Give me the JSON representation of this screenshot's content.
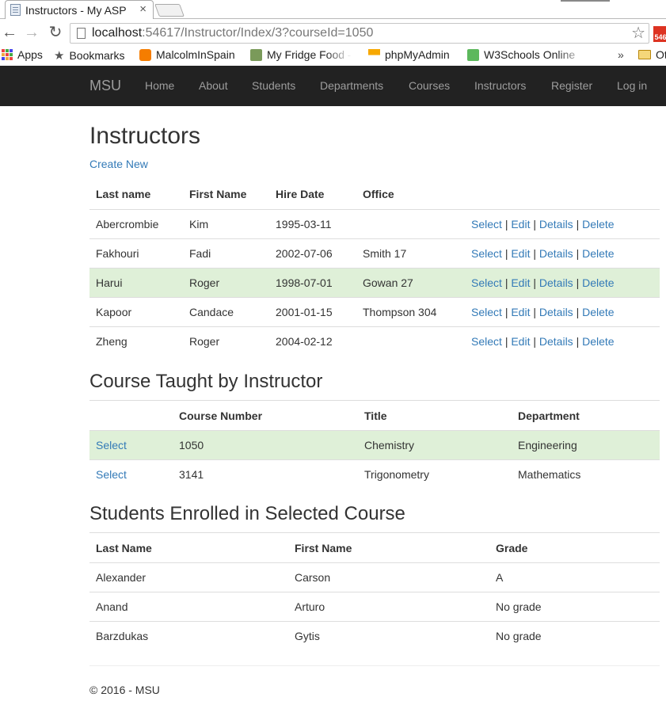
{
  "browser": {
    "tab_title": "Instructors - My ASP",
    "tab_close": "×",
    "url_host": "localhost",
    "url_rest": ":54617/Instructor/Index/3?courseId=1050",
    "ext_badge": "546",
    "bookmarks": {
      "apps": "Apps",
      "bookmarks": "Bookmarks",
      "malcolm": "MalcolmInSpain",
      "fridge": "My Fridge Food -",
      "pma": "phpMyAdmin",
      "w3": "W3Schools Online",
      "more": "»",
      "other": "Ot"
    }
  },
  "nav": {
    "brand": "MSU",
    "links": [
      "Home",
      "About",
      "Students",
      "Departments",
      "Courses",
      "Instructors",
      "Register",
      "Log in"
    ]
  },
  "page": {
    "title": "Instructors",
    "create_new": "Create New"
  },
  "instructors": {
    "headers": [
      "Last name",
      "First Name",
      "Hire Date",
      "Office"
    ],
    "actions": [
      "Select",
      "Edit",
      "Details",
      "Delete"
    ],
    "rows": [
      {
        "last": "Abercrombie",
        "first": "Kim",
        "hire": "1995-03-11",
        "office": ""
      },
      {
        "last": "Fakhouri",
        "first": "Fadi",
        "hire": "2002-07-06",
        "office": "Smith 17"
      },
      {
        "last": "Harui",
        "first": "Roger",
        "hire": "1998-07-01",
        "office": "Gowan 27"
      },
      {
        "last": "Kapoor",
        "first": "Candace",
        "hire": "2001-01-15",
        "office": "Thompson 304"
      },
      {
        "last": "Zheng",
        "first": "Roger",
        "hire": "2004-02-12",
        "office": ""
      }
    ]
  },
  "courses": {
    "title": "Course Taught by Instructor",
    "headers": [
      "",
      "Course Number",
      "Title",
      "Department"
    ],
    "select_label": "Select",
    "rows": [
      {
        "number": "1050",
        "title": "Chemistry",
        "department": "Engineering"
      },
      {
        "number": "3141",
        "title": "Trigonometry",
        "department": "Mathematics"
      }
    ]
  },
  "students": {
    "title": "Students Enrolled in Selected Course",
    "headers": [
      "Last Name",
      "First Name",
      "Grade"
    ],
    "rows": [
      {
        "last": "Alexander",
        "first": "Carson",
        "grade": "A"
      },
      {
        "last": "Anand",
        "first": "Arturo",
        "grade": "No grade"
      },
      {
        "last": "Barzdukas",
        "first": "Gytis",
        "grade": "No grade"
      }
    ]
  },
  "footer": "© 2016 - MSU",
  "colors": {
    "navbar": "#222222",
    "link": "#337ab7",
    "selected_row": "#dff0d8"
  }
}
